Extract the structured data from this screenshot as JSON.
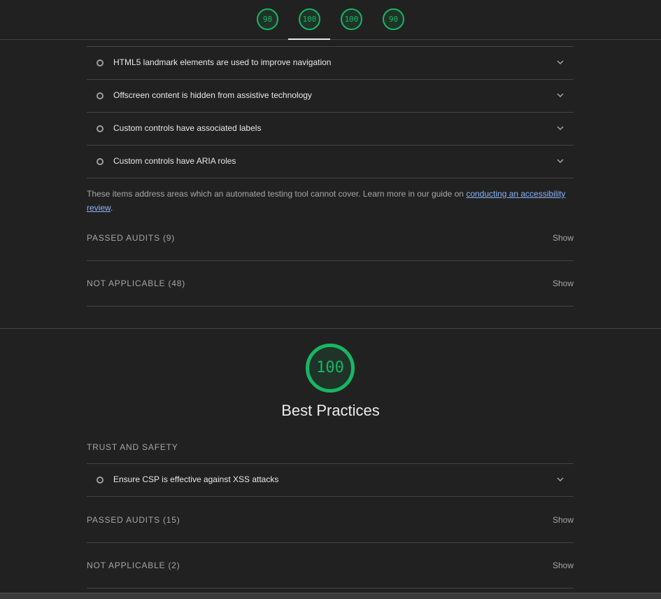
{
  "colors": {
    "pass": "#18b663",
    "link": "#8ab4f8"
  },
  "scores_nav": [
    {
      "value": "98",
      "fraction": 0.98
    },
    {
      "value": "100",
      "fraction": 1.0
    },
    {
      "value": "100",
      "fraction": 1.0
    },
    {
      "value": "90",
      "fraction": 0.9
    }
  ],
  "manual_audits": [
    {
      "label": "HTML5 landmark elements are used to improve navigation"
    },
    {
      "label": "Offscreen content is hidden from assistive technology"
    },
    {
      "label": "Custom controls have associated labels"
    },
    {
      "label": "Custom controls have ARIA roles"
    }
  ],
  "manual_note": {
    "text": "These items address areas which an automated testing tool cannot cover. Learn more in our guide on ",
    "link": "conducting an accessibility review",
    "end": "."
  },
  "accessibility_groups": {
    "passed": "PASSED AUDITS (9)",
    "not_applicable": "NOT APPLICABLE (48)",
    "show": "Show"
  },
  "best_practices": {
    "score": "100",
    "score_fraction": 1.0,
    "title": "Best Practices",
    "subheading": "TRUST AND SAFETY",
    "audit": "Ensure CSP is effective against XSS attacks",
    "passed": "PASSED AUDITS (15)",
    "not_applicable": "NOT APPLICABLE (2)",
    "show": "Show"
  }
}
